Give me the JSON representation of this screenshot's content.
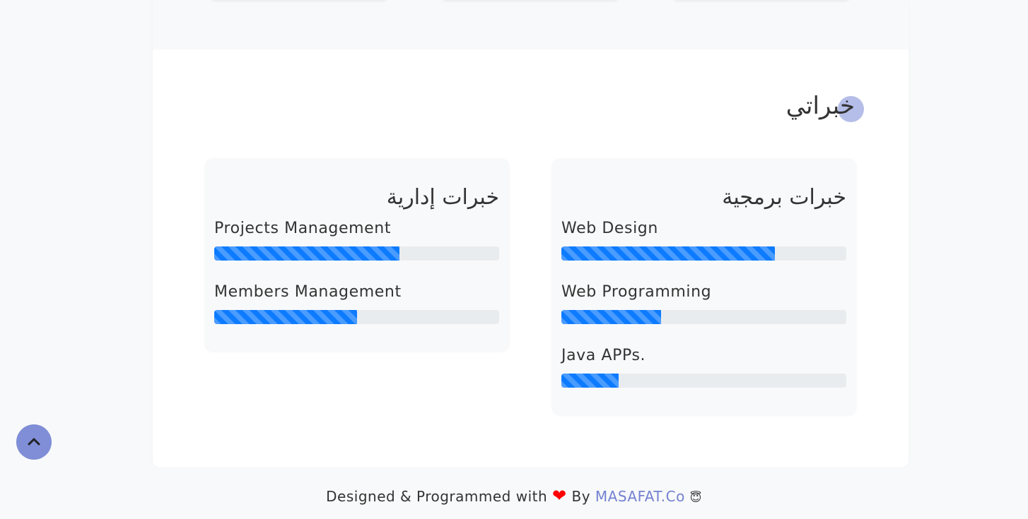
{
  "section": {
    "title": "خبراتي"
  },
  "programming_card": {
    "title": "خبرات برمجية",
    "skills": [
      {
        "label": "Web Design",
        "percent": 75
      },
      {
        "label": "Web Programming",
        "percent": 35
      },
      {
        "label": "Java APPs.",
        "percent": 20
      }
    ]
  },
  "management_card": {
    "title": "خبرات إدارية",
    "skills": [
      {
        "label": "Projects Management",
        "percent": 65
      },
      {
        "label": "Members Management",
        "percent": 50
      }
    ]
  },
  "footer": {
    "prefix": "Designed & Programmed with",
    "heart": "❤",
    "by": "By",
    "link": "MASAFAT.Co",
    "emoji": "😇"
  },
  "scroll_top": {
    "icon": "chevron-up-icon"
  },
  "colors": {
    "progress": "#0d7bff",
    "accent": "#7f8ed6"
  }
}
